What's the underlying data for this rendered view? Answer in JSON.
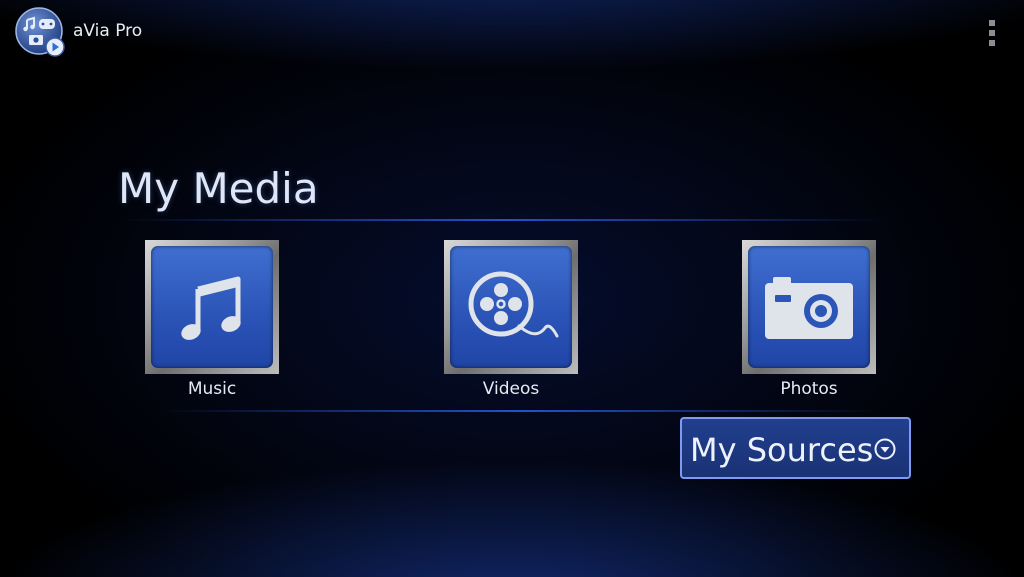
{
  "app": {
    "title": "aVia Pro",
    "icon": "avia-app-icon"
  },
  "action_bar": {
    "overflow_icon": "overflow-menu-icon"
  },
  "main": {
    "section_title": "My Media",
    "tiles": [
      {
        "label": "Music",
        "icon": "music-note-icon"
      },
      {
        "label": "Videos",
        "icon": "film-reel-icon"
      },
      {
        "label": "Photos",
        "icon": "camera-icon"
      }
    ],
    "sources_button": {
      "label": "My Sources",
      "icon": "chevron-down-circle-icon"
    }
  },
  "colors": {
    "tile_blue": "#2c55b8",
    "accent_border": "#7f9bf0",
    "background": "#000000"
  }
}
